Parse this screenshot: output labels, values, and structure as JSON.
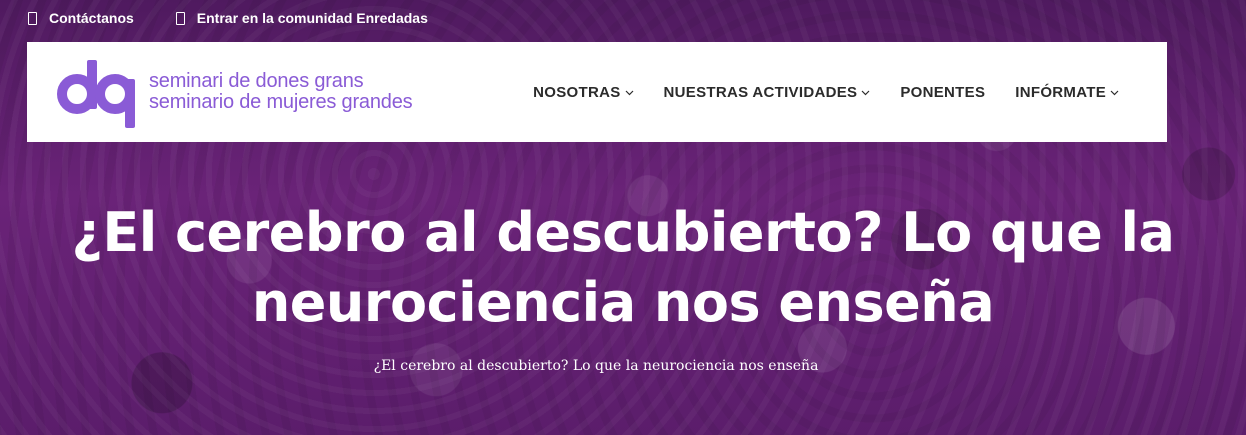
{
  "topbar": {
    "contact_label": "Contáctanos",
    "contact_icon": "phone-icon",
    "community_label": "Entrar en la comunidad Enredadas",
    "community_icon": "mobile-icon"
  },
  "header": {
    "logo": {
      "line1": "seminari de dones grans",
      "line2": "seminario de mujeres grandes",
      "color": "#8a5bd6"
    },
    "nav": [
      {
        "label": "NOSOTRAS",
        "has_dropdown": true
      },
      {
        "label": "NUESTRAS ACTIVIDADES",
        "has_dropdown": true
      },
      {
        "label": "PONENTES",
        "has_dropdown": false
      },
      {
        "label": "INFÓRMATE",
        "has_dropdown": true
      }
    ]
  },
  "hero": {
    "title": "¿El cerebro al descubierto? Lo que la neurociencia nos enseña",
    "subtitle": "¿El cerebro al descubierto? Lo que la neurociencia nos enseña",
    "overlay_color": "#5e1f6e"
  }
}
